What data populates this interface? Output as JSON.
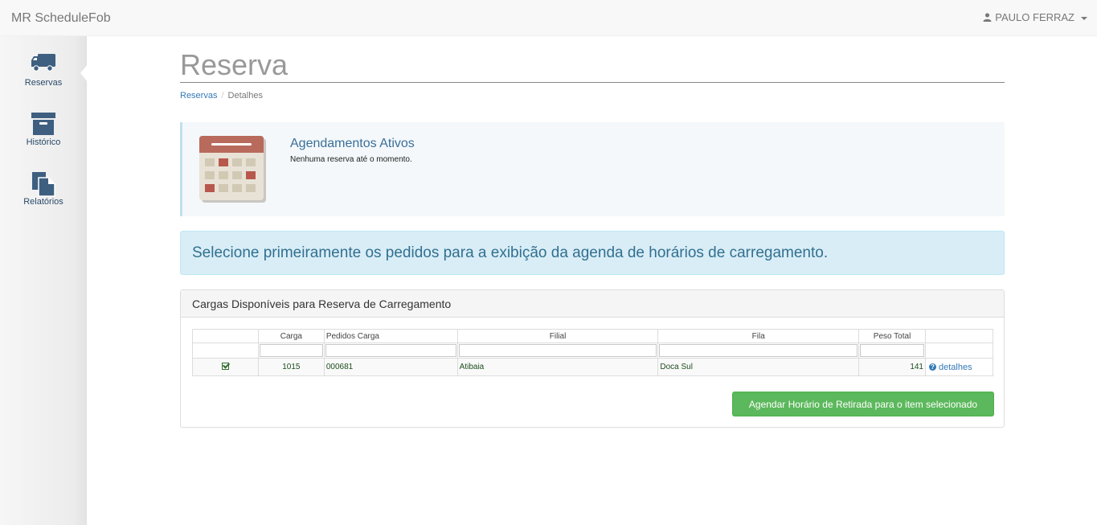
{
  "navbar": {
    "brand": "MR ScheduleFob",
    "user_name": "PAULO FERRAZ"
  },
  "sidebar": {
    "items": [
      {
        "label": "Reservas",
        "icon": "truck-icon"
      },
      {
        "label": "Histórico",
        "icon": "archive-box-icon"
      },
      {
        "label": "Relatórios",
        "icon": "documents-icon"
      }
    ]
  },
  "header": {
    "title": "Reserva",
    "breadcrumb": [
      "Reservas",
      "Detalhes"
    ]
  },
  "active_panel": {
    "title": "Agendamentos Ativos",
    "subtitle": "Nenhuma reserva até o momento."
  },
  "alert": {
    "text": "Selecione primeiramente os pedidos para a exibição da agenda de horários de carregamento."
  },
  "cargas_panel": {
    "title": "Cargas Disponíveis para Reserva de Carregamento",
    "columns": [
      "",
      "Carga",
      "Pedidos Carga",
      "Filial",
      "Fila",
      "Peso Total",
      ""
    ],
    "rows": [
      {
        "carga": "1015",
        "pedidos": "000681",
        "filial": "Atibaia",
        "fila": "Doca Sul",
        "peso": "141",
        "details_label": "detalhes"
      }
    ],
    "button_label": "Agendar Horário de Retirada para o item selecionado"
  },
  "colors": {
    "accent": "#337ab7",
    "success": "#5cb85c",
    "info_bg": "#d9edf7"
  }
}
